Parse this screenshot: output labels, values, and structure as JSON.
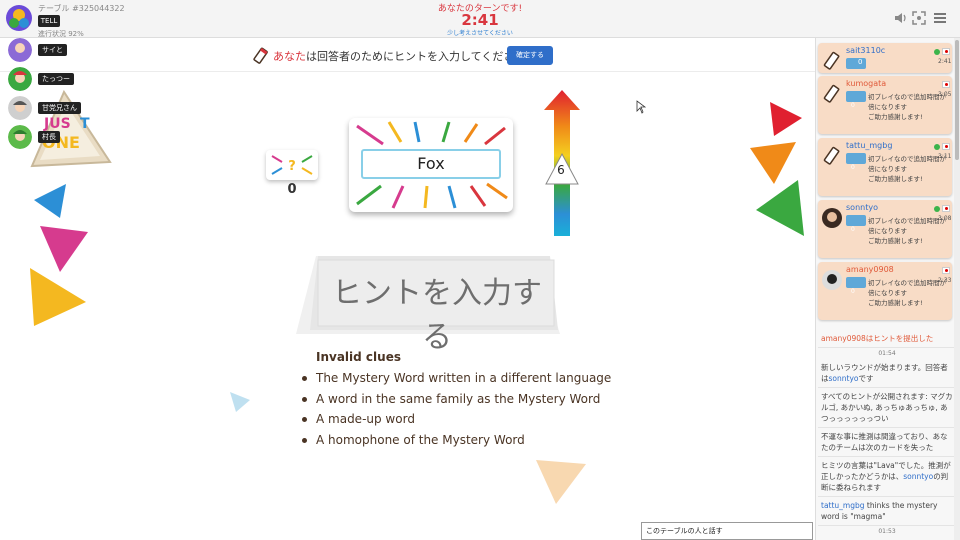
{
  "header": {
    "table_no": "テーブル #325044322",
    "progress": "進行状況 92%",
    "tell_label": "TELL",
    "turn_message": "あなたのターンです!",
    "timer": "2:41",
    "think_message": "少し考えさせてください"
  },
  "game_logo": "JUST ONE",
  "instruction": {
    "you": "あなた",
    "rest": "は回答者のためにヒントを入力してください",
    "confirm_button": "確定する"
  },
  "players_left": [
    {
      "name": "サイと"
    },
    {
      "name": "たっつー"
    },
    {
      "name": "甘党兄さん"
    },
    {
      "name": "村長"
    }
  ],
  "board": {
    "score": "0",
    "mystery_word": "Fox",
    "round_number": "6",
    "hint_placeholder": "ヒントを入力する"
  },
  "invalid_clues": {
    "title": "Invalid clues",
    "items": [
      "The Mystery Word written in a different language",
      "A word in the same family as the Mystery Word",
      "A made-up word",
      "A homophone of the Mystery Word"
    ]
  },
  "player_cards": [
    {
      "name": "sait3110c",
      "time": "2:41",
      "badge": "0",
      "msg": ""
    },
    {
      "name": "kumogata",
      "time": "3:05",
      "badge": "",
      "msg": "初プレイなので追加時間が倍になります\nご助力感謝します!"
    },
    {
      "name": "tattu_mgbg",
      "time": "3:11",
      "badge": "",
      "msg": "初プレイなので追加時間が倍になります\nご助力感謝します!"
    },
    {
      "name": "sonntyo",
      "time": "3:08",
      "badge": "",
      "msg": "初プレイなので追加時間が倍になります\nご助力感謝します!"
    },
    {
      "name": "amany0908",
      "time": "2:33",
      "badge": "",
      "msg": "初プレイなので追加時間が倍になります\nご助力感謝します!"
    }
  ],
  "badge_zero": "0",
  "log": {
    "e1": "amany0908はヒントを提出した",
    "t1": "01:54",
    "e2a": "新しいラウンドが始まります。回答者は",
    "e2b": "sonntyo",
    "e2c": "です",
    "e3": "すべてのヒントが公開されます: マグカルゴ, あかいぬ, あっちゅあっちゅ, あつっっっっっっつい",
    "e4": "不運な事に推測は間違っており、あなたのチームは次のカードを失った",
    "e5a": "ヒミツの言葉は\"Lava\"でした。推測が正しかったかどうかは、",
    "e5b": "sonntyo",
    "e5c": "の判断に委ねられます",
    "e6a": "tattu_mgbg",
    "e6b": " thinks the mystery word is \"magma\"",
    "t2": "01:53"
  },
  "talk_box": "このテーブルの人と話す",
  "colors": {
    "accent_red": "#d9363e",
    "button_blue": "#2f6ec9",
    "player_card_bg": "#f8dcc6"
  }
}
